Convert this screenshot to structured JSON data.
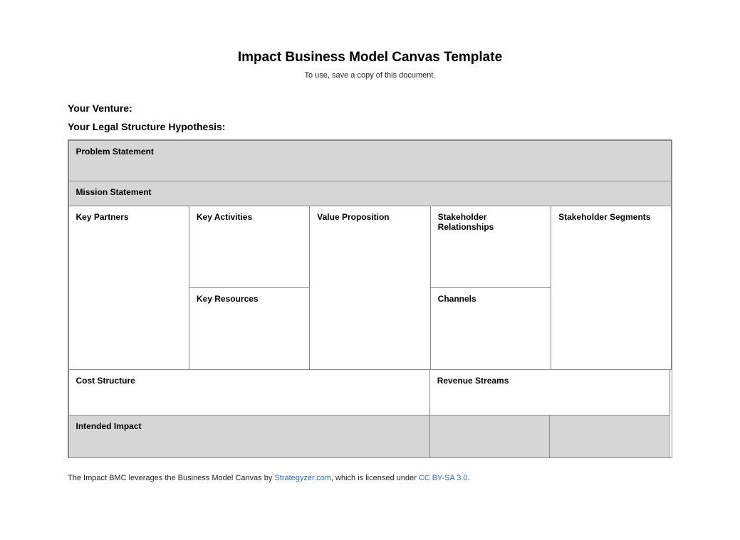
{
  "title": "Impact Business Model Canvas Template",
  "subtitle": "To use, save a copy of this document.",
  "meta": {
    "venture_label": "Your Venture:",
    "legal_label": "Your Legal Structure Hypothesis:"
  },
  "sections": {
    "problem": "Problem Statement",
    "mission": "Mission Statement",
    "key_partners": "Key Partners",
    "key_activities": "Key Activities",
    "key_resources": "Key Resources",
    "value_proposition": "Value Proposition",
    "stakeholder_relationships": "Stakeholder Relationships",
    "channels": "Channels",
    "stakeholder_segments": "Stakeholder Segments",
    "cost_structure": "Cost Structure",
    "revenue_streams": "Revenue Streams",
    "intended_impact": "Intended Impact"
  },
  "footer": {
    "pre": "The Impact BMC leverages the Business Model Canvas by ",
    "link1_text": "Strategyzer.com",
    "mid": ", which is licensed under ",
    "link2_text": "CC BY-SA 3.0",
    "post": "."
  }
}
